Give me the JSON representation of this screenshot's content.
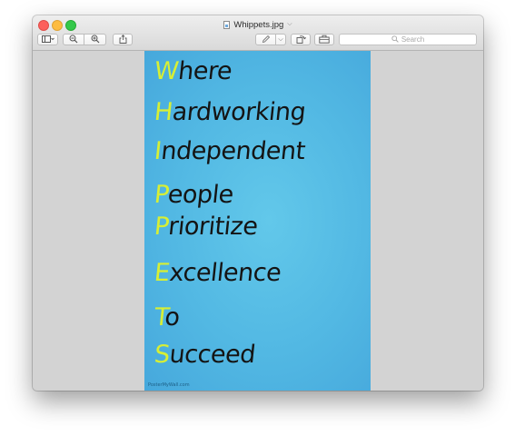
{
  "window": {
    "title": "Whippets.jpg"
  },
  "toolbar": {
    "search_placeholder": "Search"
  },
  "poster": {
    "words": [
      {
        "initial": "W",
        "rest": "here"
      },
      {
        "initial": "H",
        "rest": "ardworking"
      },
      {
        "initial": "I",
        "rest": "ndependent"
      },
      {
        "initial": "P",
        "rest": "eople"
      },
      {
        "initial": "P",
        "rest": "rioritize"
      },
      {
        "initial": "E",
        "rest": "xcellence"
      },
      {
        "initial": "T",
        "rest": "o"
      },
      {
        "initial": "S",
        "rest": "ucceed"
      }
    ],
    "watermark": "PosterMyWall.com"
  },
  "colors": {
    "poster_background": "#52b8e3",
    "initial_letter": "#d7ef35",
    "word_text": "#141414",
    "close_button": "#fc605c",
    "minimize_button": "#fdbc40",
    "zoom_button": "#34c84a"
  },
  "icons": [
    "sidebar-icon",
    "zoom-out-icon",
    "zoom-in-icon",
    "share-icon",
    "markup-pen-icon",
    "rotate-icon",
    "toolbox-icon",
    "search-icon"
  ]
}
